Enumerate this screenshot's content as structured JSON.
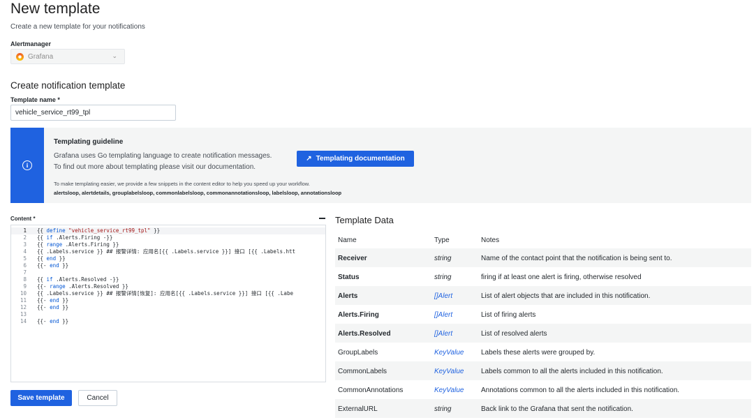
{
  "page": {
    "title": "New template",
    "subtitle": "Create a new template for your notifications"
  },
  "alertmanager": {
    "label": "Alertmanager",
    "value": "Grafana",
    "icon": "grafana-logo-icon"
  },
  "form": {
    "section_title": "Create notification template",
    "template_name_label": "Template name *",
    "template_name_value": "vehicle_service_rt99_tpl",
    "content_label": "Content *"
  },
  "guideline": {
    "title": "Templating guideline",
    "line1": "Grafana uses Go templating language to create notification messages.",
    "line2": "To find out more about templating please visit our documentation.",
    "button_label": "Templating documentation",
    "snippets_intro": "To make templating easier, we provide a few snippets in the content editor to help you speed up your workflow.",
    "snippets_list": "alertsloop, alertdetails, grouplabelsloop, commonlabelsloop, commonannotationsloop, labelsloop, annotationsloop"
  },
  "editor": {
    "lines": [
      {
        "n": "1",
        "parts": [
          [
            "p",
            "{{ "
          ],
          [
            "k",
            "define "
          ],
          [
            "s",
            "\"vehicle_service_rt99_tpl\""
          ],
          [
            "p",
            " }}"
          ]
        ]
      },
      {
        "n": "2",
        "parts": [
          [
            "p",
            "{{ "
          ],
          [
            "k",
            "if"
          ],
          [
            "p",
            " .Alerts.Firing -}}"
          ]
        ]
      },
      {
        "n": "3",
        "parts": [
          [
            "p",
            "{{ "
          ],
          [
            "k",
            "range"
          ],
          [
            "p",
            " .Alerts.Firing }}"
          ]
        ]
      },
      {
        "n": "4",
        "parts": [
          [
            "p",
            "{{ .Labels.service }} ## 报警详情: 应用名[{{ .Labels.service }}] 接口 [{{ .Labels.htt"
          ]
        ]
      },
      {
        "n": "5",
        "parts": [
          [
            "p",
            "{{ "
          ],
          [
            "k",
            "end"
          ],
          [
            "p",
            " }}"
          ]
        ]
      },
      {
        "n": "6",
        "parts": [
          [
            "p",
            "{{- "
          ],
          [
            "k",
            "end"
          ],
          [
            "p",
            " }}"
          ]
        ]
      },
      {
        "n": "7",
        "parts": []
      },
      {
        "n": "8",
        "parts": [
          [
            "p",
            "{{ "
          ],
          [
            "k",
            "if"
          ],
          [
            "p",
            " .Alerts.Resolved -}}"
          ]
        ]
      },
      {
        "n": "9",
        "parts": [
          [
            "p",
            "{{- "
          ],
          [
            "k",
            "range"
          ],
          [
            "p",
            " .Alerts.Resolved }}"
          ]
        ]
      },
      {
        "n": "10",
        "parts": [
          [
            "p",
            "{{ .Labels.service }} ## 报警详情[恢复]: 应用名[{{ .Labels.service }}] 接口 [{{ .Labe"
          ]
        ]
      },
      {
        "n": "11",
        "parts": [
          [
            "p",
            "{{- "
          ],
          [
            "k",
            "end"
          ],
          [
            "p",
            " }}"
          ]
        ]
      },
      {
        "n": "12",
        "parts": [
          [
            "p",
            "{{- "
          ],
          [
            "k",
            "end"
          ],
          [
            "p",
            " }}"
          ]
        ]
      },
      {
        "n": "13",
        "parts": []
      },
      {
        "n": "14",
        "parts": [
          [
            "p",
            "{{- "
          ],
          [
            "k",
            "end"
          ],
          [
            "p",
            " }}"
          ]
        ]
      }
    ]
  },
  "actions": {
    "save_label": "Save template",
    "cancel_label": "Cancel"
  },
  "template_data": {
    "title": "Template Data",
    "headers": [
      "Name",
      "Type",
      "Notes"
    ],
    "rows": [
      {
        "name": "Receiver",
        "type": "string",
        "notes": "Name of the contact point that the notification is being sent to.",
        "bold": true,
        "link": false
      },
      {
        "name": "Status",
        "type": "string",
        "notes": "firing if at least one alert is firing, otherwise resolved",
        "bold": true,
        "link": false
      },
      {
        "name": "Alerts",
        "type": "[]Alert",
        "notes": "List of alert objects that are included in this notification.",
        "bold": true,
        "link": true
      },
      {
        "name": "Alerts.Firing",
        "type": "[]Alert",
        "notes": "List of firing alerts",
        "bold": true,
        "link": true
      },
      {
        "name": "Alerts.Resolved",
        "type": "[]Alert",
        "notes": "List of resolved alerts",
        "bold": true,
        "link": true
      },
      {
        "name": "GroupLabels",
        "type": "KeyValue",
        "notes": "Labels these alerts were grouped by.",
        "bold": false,
        "link": true
      },
      {
        "name": "CommonLabels",
        "type": "KeyValue",
        "notes": "Labels common to all the alerts included in this notification.",
        "bold": false,
        "link": true
      },
      {
        "name": "CommonAnnotations",
        "type": "KeyValue",
        "notes": "Annotations common to all the alerts included in this notification.",
        "bold": false,
        "link": true
      },
      {
        "name": "ExternalURL",
        "type": "string",
        "notes": "Back link to the Grafana that sent the notification.",
        "bold": false,
        "link": false
      }
    ]
  },
  "colors": {
    "primary": "#1f62e0",
    "panel_bg": "#f4f5f5",
    "keyword": "#0055d4",
    "string": "#a31515"
  }
}
